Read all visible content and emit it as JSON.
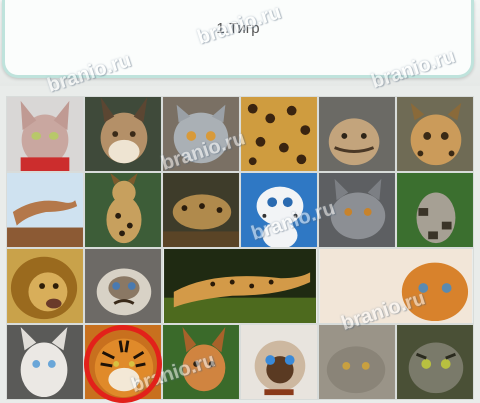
{
  "question": {
    "number": "1.",
    "answer": "Тигр"
  },
  "watermark_text": "branio.ru",
  "selection": {
    "selected_tile": "tiger",
    "ring_color": "#e2211a"
  },
  "tiles": [
    "sphynx-cat-icon",
    "lynx-icon",
    "british-shorthair-icon",
    "jaguar-icon",
    "ocelot-kitten-icon",
    "ocelot-icon",
    "cougar-icon",
    "serval-icon",
    "leopard-cub-icon",
    "snow-leopard-cartoon-icon",
    "russian-blue-cat-icon",
    "clouded-leopard-icon",
    "lion-icon",
    "grumpy-cat-icon",
    "cheetah-icon",
    "persian-kitten-icon",
    "siamese-cat-icon",
    "tiger-icon",
    "caracal-icon",
    "siamese-kitten-icon",
    "pallas-cat-icon",
    "manul-icon"
  ]
}
